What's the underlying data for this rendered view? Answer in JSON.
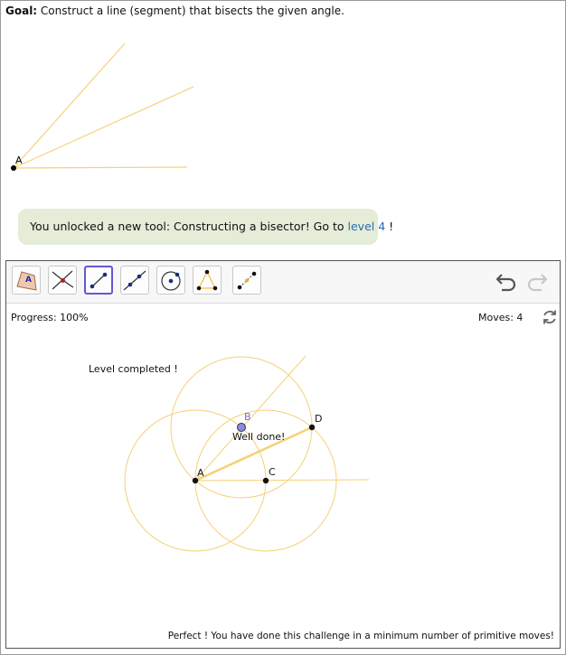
{
  "goal": {
    "prefix": "Goal:",
    "text": " Construct a line (segment) that bisects the given angle."
  },
  "preview": {
    "point_label": "A",
    "line_color": "#f5d178"
  },
  "banner": {
    "text_before": "You unlocked a new tool: Constructing a bisector! Go to ",
    "link": "level 4",
    "text_after": " !",
    "background": "#e5ecd8",
    "link_color": "#2a6bb5"
  },
  "toolbar": {
    "tools": [
      {
        "icon": "polygon-move-icon",
        "selected": false
      },
      {
        "icon": "intersect-icon",
        "selected": false
      },
      {
        "icon": "segment-icon",
        "selected": true
      },
      {
        "icon": "line-icon",
        "selected": false
      },
      {
        "icon": "circle-icon",
        "selected": false
      },
      {
        "icon": "triangle-points-icon",
        "selected": false
      },
      {
        "icon": "midpoint-icon",
        "selected": false
      }
    ],
    "undo_icon": "undo-icon",
    "redo_icon": "redo-icon",
    "accent": "#6557d2"
  },
  "status": {
    "progress": "Progress: 100%",
    "moves": "Moves: 4",
    "reset_icon": "reset-icon"
  },
  "canvas": {
    "level_message": "Level completed !",
    "well_done": "Well done!",
    "points": {
      "A": "A",
      "B": "B",
      "C": "C",
      "D": "D"
    },
    "circle_color": "#f5d178",
    "point_b_color": "#8a8ae6",
    "footer": "Perfect ! You have done this challenge in a minimum number of primitive moves!"
  }
}
